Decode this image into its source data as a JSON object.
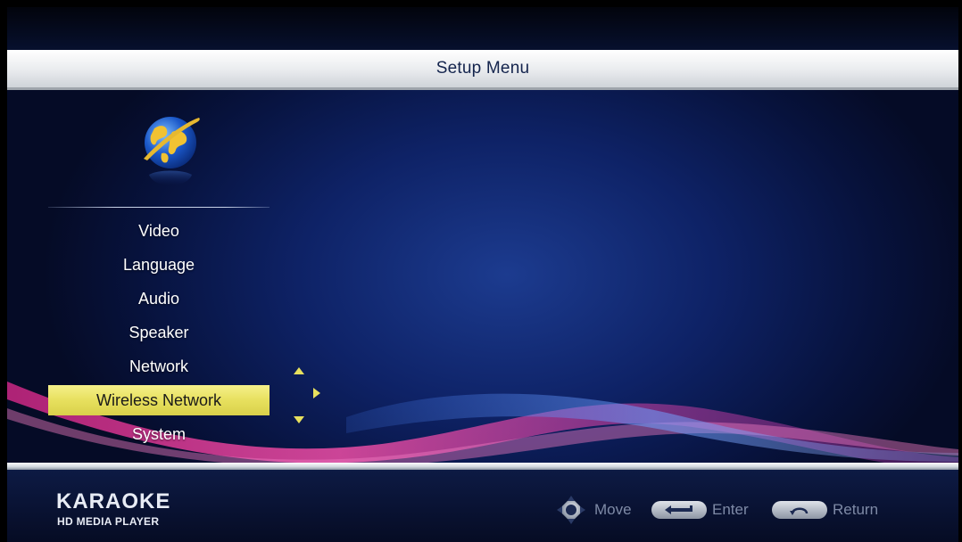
{
  "header": {
    "title": "Setup Menu"
  },
  "menu": {
    "icon": "globe-icon",
    "items": [
      {
        "label": "Video"
      },
      {
        "label": "Language"
      },
      {
        "label": "Audio"
      },
      {
        "label": "Speaker"
      },
      {
        "label": "Network"
      },
      {
        "label": "Wireless Network",
        "selected": true
      },
      {
        "label": "System"
      }
    ]
  },
  "footer": {
    "brand": "KARAOKE",
    "brand_sub": "HD MEDIA PLAYER",
    "hints": {
      "move": "Move",
      "enter": "Enter",
      "return": "Return"
    }
  },
  "colors": {
    "background": "#0e2266",
    "highlight": "#e7e05e",
    "title_text": "#14244d"
  }
}
